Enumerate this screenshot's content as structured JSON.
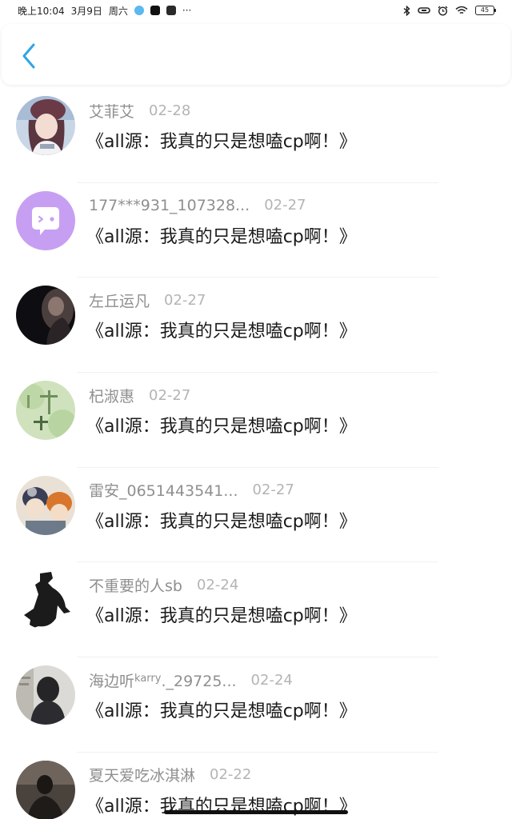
{
  "status_bar": {
    "time": "晚上10:04",
    "date": "3月9日",
    "weekday": "周六",
    "dots": "···",
    "battery": "45"
  },
  "header": {
    "back_icon": "chevron-left-icon",
    "accent": "#2ea6e6"
  },
  "comments": [
    {
      "username": "艾菲艾",
      "date": "02-28",
      "text": "《all源：我真的只是想嗑cp啊！》"
    },
    {
      "username": "177***931_107328...",
      "date": "02-27",
      "text": "《all源：我真的只是想嗑cp啊！》"
    },
    {
      "username": "左丘运凡",
      "date": "02-27",
      "text": "《all源：我真的只是想嗑cp啊！》"
    },
    {
      "username": "杞淑惠",
      "date": "02-27",
      "text": "《all源：我真的只是想嗑cp啊！》"
    },
    {
      "username": "雷安_0651443541...",
      "date": "02-27",
      "text": "《all源：我真的只是想嗑cp啊！》"
    },
    {
      "username": "不重要的人sb",
      "date": "02-24",
      "text": "《all源：我真的只是想嗑cp啊！》"
    },
    {
      "username_pre": "海边听",
      "username_sup": "karry",
      "username_post": "._29725...",
      "date": "02-24",
      "text": "《all源：我真的只是想嗑cp啊！》"
    },
    {
      "username": "夏天爱吃冰淇淋",
      "date": "02-22",
      "text": "《all源：我真的只是想嗑cp啊！》"
    }
  ]
}
